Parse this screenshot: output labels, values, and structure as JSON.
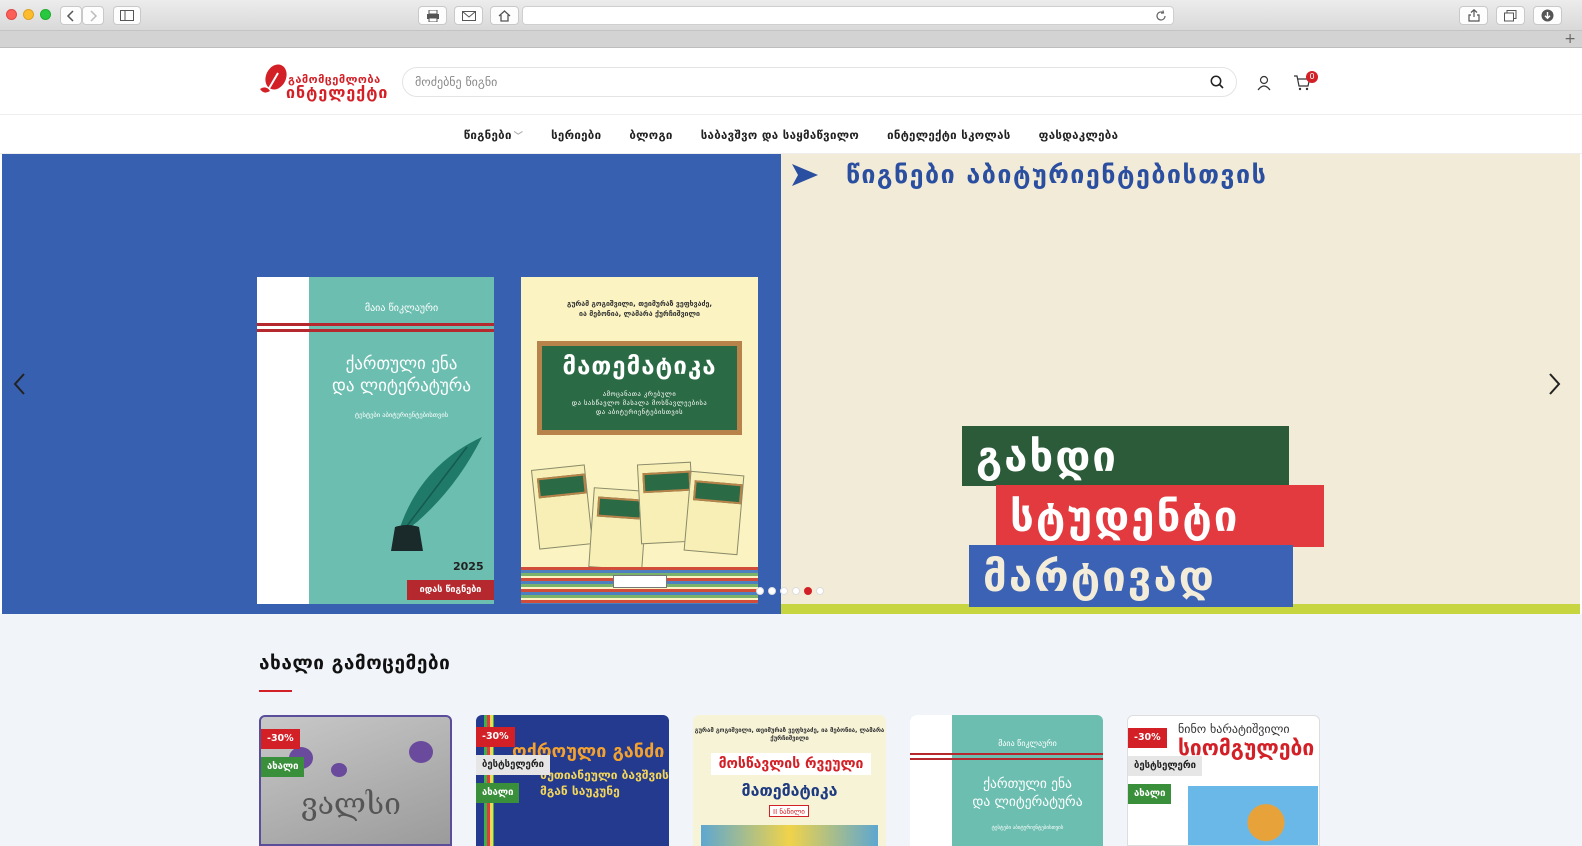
{
  "site": {
    "logo_top": "გამომცემლობა",
    "logo_bottom": "ინტელექტი",
    "search_placeholder": "მოძებნე წიგნი",
    "cart_count": "0"
  },
  "nav": {
    "items": [
      {
        "label": "წიგნები",
        "has_dropdown": true
      },
      {
        "label": "სერიები"
      },
      {
        "label": "ბლოგი"
      },
      {
        "label": "საბავშვო და საყმაწვილო"
      },
      {
        "label": "ინტელექტი სკოლას"
      },
      {
        "label": "ფასდაკლება"
      }
    ]
  },
  "hero": {
    "title": "წიგნები აბიტურიენტებისთვის",
    "book1": {
      "author": "მაია წიკლაური",
      "title_line1": "ქართული ენა",
      "title_line2": "და ლიტერატურა",
      "subtitle": "ტესტები აბიტურიენტებისთვის",
      "year": "2025",
      "publisher": "იდას წიგნები"
    },
    "book2": {
      "authors_line1": "გურამ გოგიშვილი, თეიმურაზ ვეფხვაძე,",
      "authors_line2": "ია მებონია, ლამარა ქურჩიშვილი",
      "title": "მათემატიკა",
      "subtitle_line1": "ამოცანათა კრებული",
      "subtitle_line2": "და სასწავლო მასალა მოსწავლეებისა",
      "subtitle_line3": "და აბიტურიენტებისთვის"
    },
    "poster": {
      "line1": "გახდი",
      "line2": "სტუდენტი",
      "line3": "მარტივად"
    },
    "slider": {
      "total": 6,
      "active": 5
    },
    "colors": {
      "left_bg": "#3860b0",
      "right_bg": "#f2ebd7",
      "accent": "#d32027"
    }
  },
  "new_releases": {
    "title": "ახალი გამოცემები",
    "cards": [
      {
        "tags": [
          "-30%",
          "ახალი"
        ],
        "cover_text": "ვალსი"
      },
      {
        "tags": [
          "-30%",
          "ბესტსელერი",
          "ახალი"
        ],
        "cover_line1": "ოქროული განძი",
        "cover_line2": "ხუთიანეული ბავშვის",
        "cover_line3": "მგან საუკუნე"
      },
      {
        "tags": [],
        "authors": "გურამ გოგიშვილი, თეიმურაზ ვეფხვაძე, ია მებონია, ლამარა ქურჩიშვილი",
        "label1": "მოსწავლის რვეული",
        "label2": "მათემატიკა",
        "label3": "II ნაწილი"
      },
      {
        "tags": [],
        "author": "მაია წიკლაური",
        "title_line1": "ქართული ენა",
        "title_line2": "და ლიტერატურა",
        "subtitle": "ტესტები აბიტურიენტებისთვის"
      },
      {
        "tags": [
          "-30%",
          "ბესტსელერი",
          "ახალი"
        ],
        "author": "ნინო ხარატიშვილი",
        "title": "სიომგულები"
      }
    ]
  }
}
